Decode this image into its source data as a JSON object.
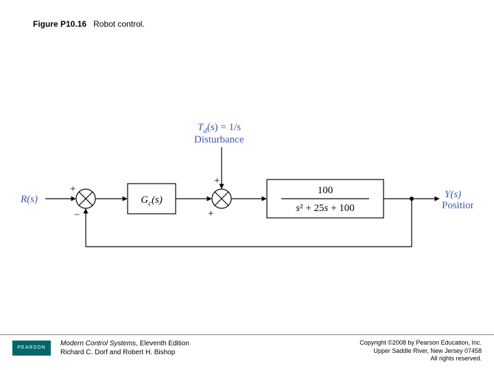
{
  "figure": {
    "number": "Figure P10.16",
    "caption": "Robot control."
  },
  "diagram": {
    "input_label": "R(s)",
    "sum1_plus": "+",
    "sum1_minus": "−",
    "controller": "G_c(s)",
    "sum2_plus_top": "+",
    "sum2_plus_left": "+",
    "disturbance_eq": "T_d(s) = 1/s",
    "disturbance_word": "Disturbance",
    "plant_numerator": "100",
    "plant_denominator": "s² + 25s + 100",
    "output_label": "Y(s)",
    "output_word": "Position"
  },
  "footer": {
    "logo_text": "PEARSON",
    "book_title": "Modern Control Systems",
    "book_edition": ", Eleventh Edition",
    "authors": "Richard C. Dorf and Robert H. Bishop",
    "copyright1": "Copyright ©2008 by Pearson Education, Inc.",
    "copyright2": "Upper Saddle River, New Jersey 07458",
    "copyright3": "All rights reserved."
  }
}
